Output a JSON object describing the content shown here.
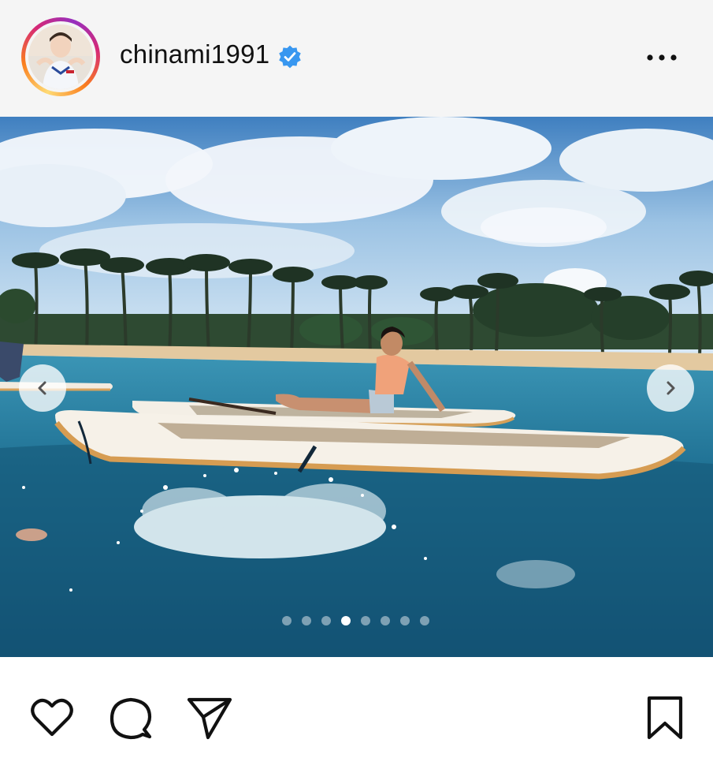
{
  "post": {
    "username": "chinami1991",
    "verified": true,
    "avatar_icon": "profile-photo",
    "more_icon": "more-horizontal-icon"
  },
  "carousel": {
    "total": 8,
    "active_index": 3,
    "prev_icon": "chevron-left-icon",
    "next_icon": "chevron-right-icon"
  },
  "actions": {
    "like_icon": "heart-icon",
    "comment_icon": "comment-icon",
    "share_icon": "send-icon",
    "save_icon": "bookmark-icon"
  },
  "colors": {
    "verified_blue": "#3897f0",
    "header_bg": "#f5f5f5",
    "icon_color": "#111111"
  }
}
